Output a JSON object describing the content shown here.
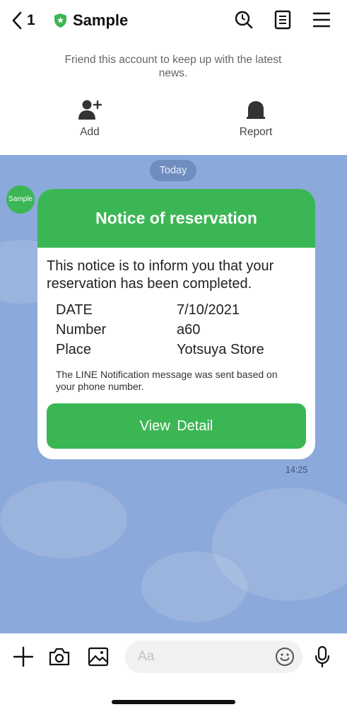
{
  "header": {
    "back_count": "1",
    "title": "Sample",
    "icons": [
      "chevron-left-icon",
      "shield-icon",
      "search-icon",
      "note-icon",
      "menu-icon"
    ]
  },
  "banner": {
    "text": "Friend this account to keep up with the latest news.",
    "add_label": "Add",
    "report_label": "Report"
  },
  "chat": {
    "date_label": "Today",
    "avatar_text": "Sample",
    "card": {
      "title": "Notice of reservation",
      "intro": "This notice is to inform you that your reservation has been completed.",
      "rows": [
        {
          "key": "DATE",
          "value": "7/10/2021"
        },
        {
          "key": "Number",
          "value": "a60"
        },
        {
          "key": "Place",
          "value": "Yotsuya Store"
        }
      ],
      "note": "The LINE Notification message was sent based on your phone number.",
      "button_label": "View  Detail"
    },
    "time": "14:25"
  },
  "input_bar": {
    "placeholder": "Aa",
    "icons": [
      "plus-icon",
      "camera-icon",
      "image-icon",
      "emoji-icon",
      "microphone-icon"
    ]
  },
  "colors": {
    "accent_green": "#3bb654",
    "chat_background": "#8ba9da"
  }
}
